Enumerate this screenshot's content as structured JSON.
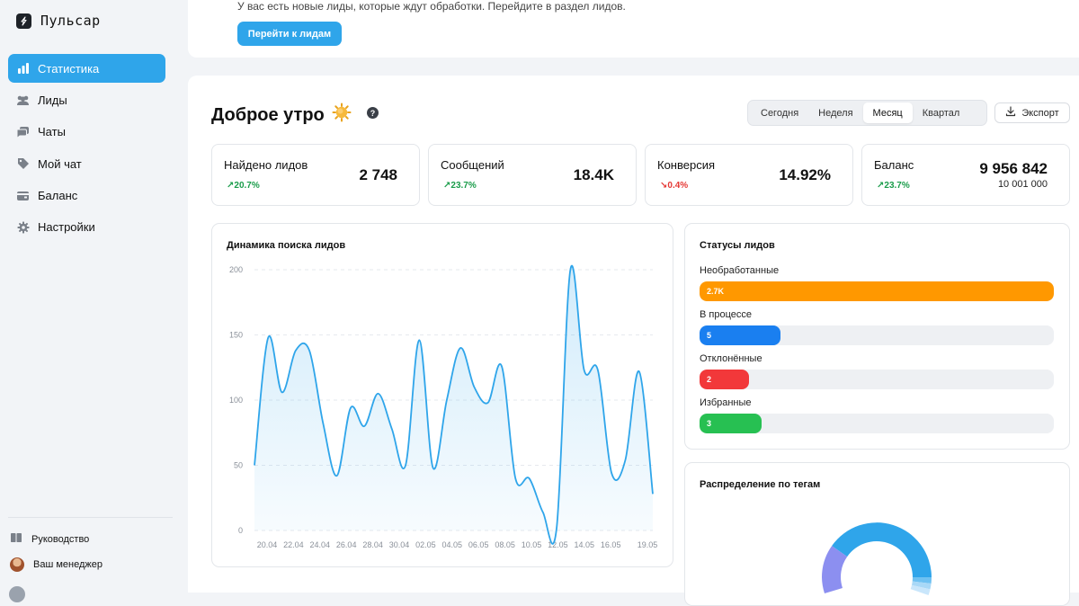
{
  "brand": {
    "name": "Пульсар",
    "logo_icon": "bolt-icon"
  },
  "sidebar": {
    "items": [
      {
        "label": "Статистика",
        "icon": "bar-chart-icon",
        "active": true
      },
      {
        "label": "Лиды",
        "icon": "users-icon",
        "active": false
      },
      {
        "label": "Чаты",
        "icon": "chat-icon",
        "active": false
      },
      {
        "label": "Мой чат",
        "icon": "tag-icon",
        "active": false
      },
      {
        "label": "Баланс",
        "icon": "wallet-icon",
        "active": false
      },
      {
        "label": "Настройки",
        "icon": "gear-icon",
        "active": false
      }
    ],
    "guide_label": "Руководство",
    "manager_label": "Ваш менеджер"
  },
  "banner": {
    "text": "У вас есть новые лиды, которые ждут обработки. Перейдите в раздел лидов.",
    "button_label": "Перейти к лидам"
  },
  "header": {
    "greeting": "Доброе утро",
    "help": "?",
    "periods": [
      "Сегодня",
      "Неделя",
      "Месяц",
      "Квартал"
    ],
    "active_period": "Месяц",
    "export_label": "Экспорт"
  },
  "kpis": [
    {
      "label": "Найдено лидов",
      "value": "2 748",
      "delta": "20.7%",
      "trend": "up"
    },
    {
      "label": "Сообщений",
      "value": "18.4K",
      "delta": "23.7%",
      "trend": "up"
    },
    {
      "label": "Конверсия",
      "value": "14.92%",
      "delta": "0.4%",
      "trend": "down"
    },
    {
      "label": "Баланс",
      "value": "9 956 842",
      "sub": "10 001 000",
      "delta": "23.7%",
      "trend": "up"
    }
  ],
  "colors": {
    "accent": "#2fa5ea",
    "up": "#1a9c4a",
    "down": "#e53935"
  },
  "chart_data": {
    "type": "area",
    "title": "Динамика поиска лидов",
    "xlabel": "",
    "ylabel": "",
    "ylim": [
      0,
      200
    ],
    "yticks": [
      0,
      50,
      100,
      150,
      200
    ],
    "x_tick_labels": [
      "20.04",
      "22.04",
      "24.04",
      "26.04",
      "28.04",
      "30.04",
      "02.05",
      "04.05",
      "06.05",
      "08.05",
      "10.05",
      "12.05",
      "14.05",
      "16.05",
      "19.05"
    ],
    "grid": true,
    "series": [
      {
        "color": "#2fa5ea",
        "values": [
          50,
          148,
          106,
          138,
          138,
          82,
          42,
          94,
          80,
          105,
          78,
          50,
          146,
          48,
          100,
          140,
          110,
          98,
          126,
          40,
          40,
          14,
          2,
          200,
          123,
          123,
          44,
          54,
          122,
          28
        ]
      }
    ]
  },
  "statuses": {
    "title": "Статусы лидов",
    "items": [
      {
        "name": "Необработанные",
        "value": "2.7K",
        "fraction": 1.0,
        "color": "#ff9800"
      },
      {
        "name": "В процессе",
        "value": "5",
        "fraction": 0.228,
        "color": "#1a7ff0"
      },
      {
        "name": "Отклонённые",
        "value": "2",
        "fraction": 0.14,
        "color": "#f2383a"
      },
      {
        "name": "Избранные",
        "value": "3",
        "fraction": 0.176,
        "color": "#27c052"
      }
    ]
  },
  "tags_title": "Распределение по тегам"
}
